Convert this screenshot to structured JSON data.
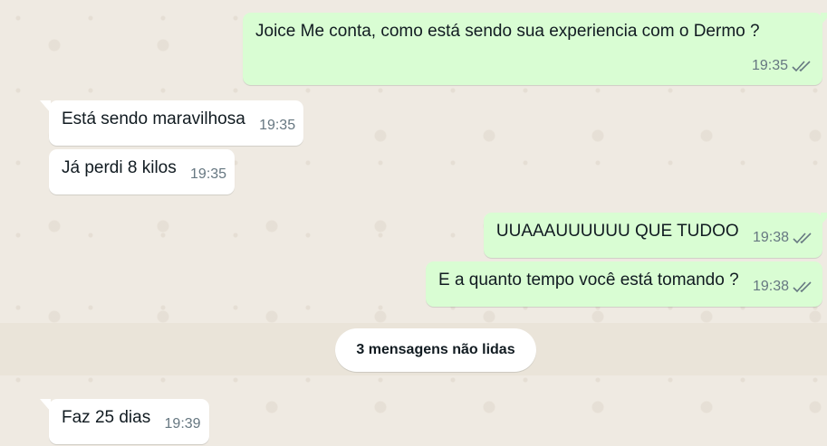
{
  "messages": [
    {
      "id": "m1",
      "direction": "out",
      "text": "Joice Me conta, como está sendo sua experiencia com o Dermo ?",
      "time": "19:35",
      "status": "read"
    },
    {
      "id": "m2",
      "direction": "in",
      "text": "Está sendo maravilhosa",
      "time": "19:35"
    },
    {
      "id": "m3",
      "direction": "in",
      "text": "Já perdi 8 kilos",
      "time": "19:35"
    },
    {
      "id": "m4",
      "direction": "out",
      "text": "UUAAAUUUUUU QUE TUDOO",
      "time": "19:38",
      "status": "read"
    },
    {
      "id": "m5",
      "direction": "out",
      "text": "E a quanto tempo você está tomando ?",
      "time": "19:38",
      "status": "read"
    },
    {
      "id": "m6",
      "direction": "in",
      "text": "Faz 25 dias",
      "time": "19:39"
    }
  ],
  "unread_divider": "3 mensagens não lidas",
  "colors": {
    "outgoing_bubble": "#d9fdd3",
    "incoming_bubble": "#ffffff",
    "background": "#efeae2",
    "meta_text": "#667781"
  },
  "icons": {
    "read_receipt": "double-check-icon"
  }
}
